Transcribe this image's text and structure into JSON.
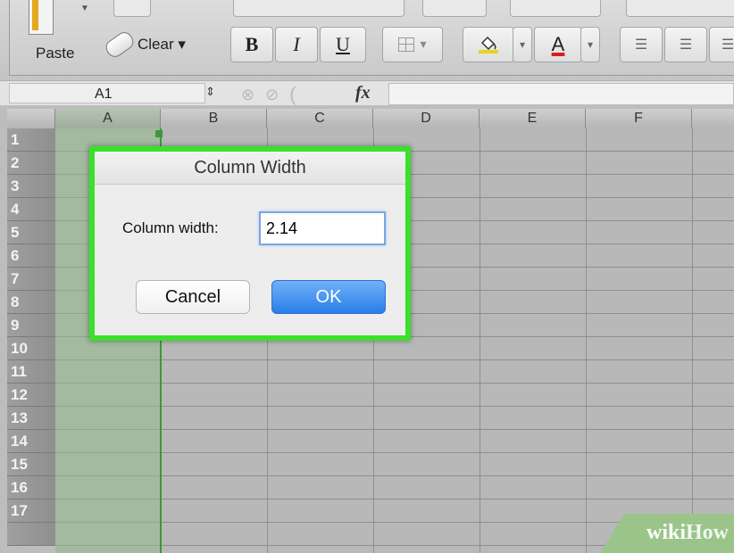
{
  "toolbar": {
    "paste_label": "Paste",
    "clear_label": "Clear ▾",
    "bold": "B",
    "italic": "I",
    "underline": "U",
    "borders_arrow": "▾",
    "fill_arrow": "▾",
    "font_color_label": "A",
    "font_color_arrow": "▾"
  },
  "formula_bar": {
    "name_box": "A1",
    "stepper": "⇕",
    "cancel_icon": "⊗",
    "confirm_icon": "⊘",
    "fx_label": "fx"
  },
  "columns": [
    "A",
    "B",
    "C",
    "D",
    "E",
    "F"
  ],
  "rows": [
    "1",
    "2",
    "3",
    "4",
    "5",
    "6",
    "7",
    "8",
    "9",
    "10",
    "11",
    "12",
    "13",
    "14",
    "15",
    "16",
    "17"
  ],
  "dialog": {
    "title": "Column Width",
    "field_label": "Column width:",
    "field_value": "2.14",
    "cancel": "Cancel",
    "ok": "OK"
  },
  "colors": {
    "highlight": "#3be02c",
    "ok_button": "#2a7de8",
    "selection": "#91b98c"
  },
  "watermark": "wikiHow"
}
